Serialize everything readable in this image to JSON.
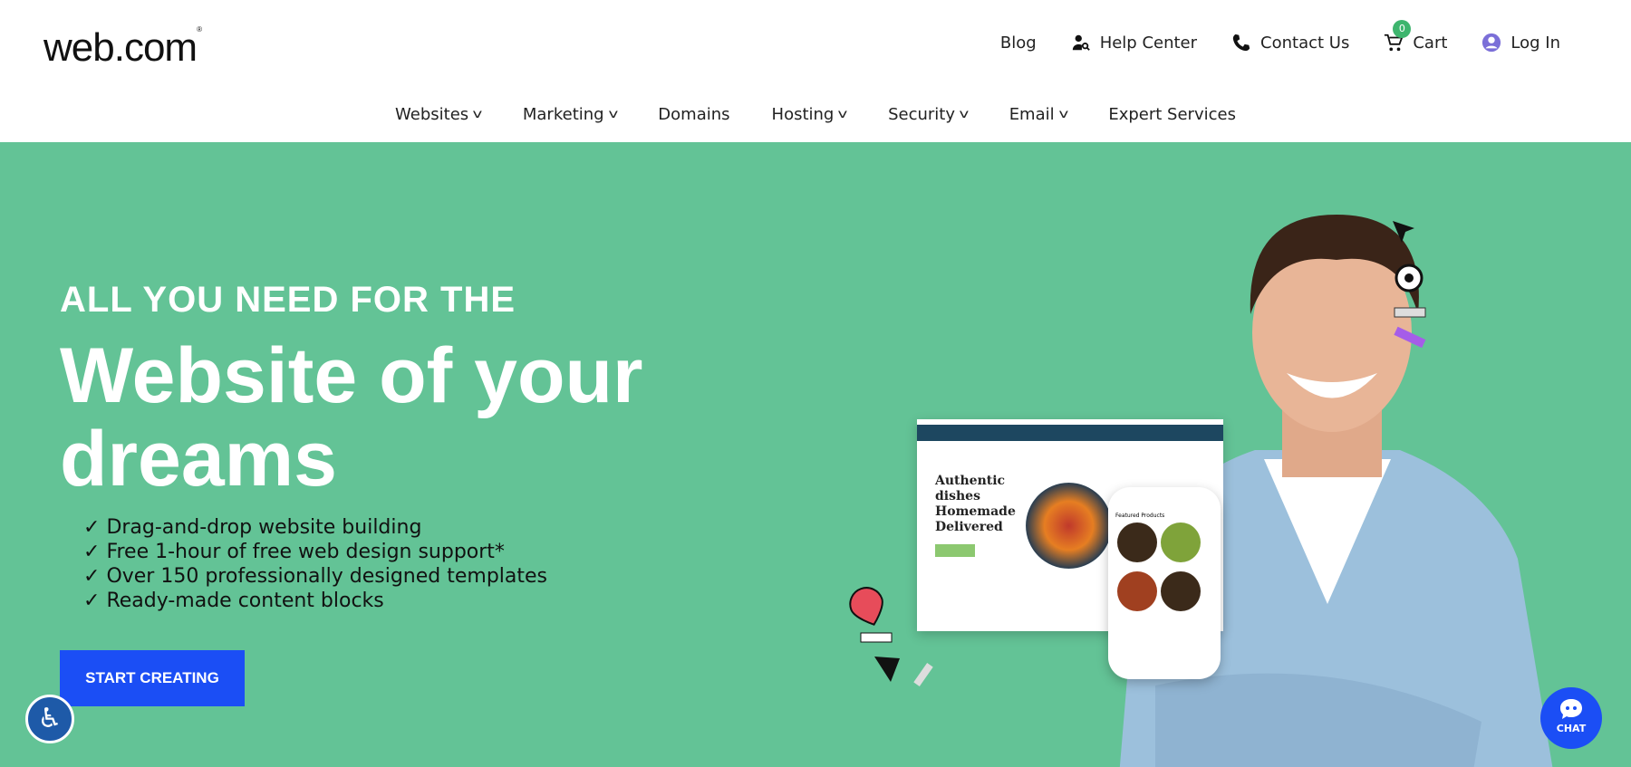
{
  "header": {
    "logo": "web.com",
    "util": [
      {
        "label": "Blog",
        "icon": "none"
      },
      {
        "label": "Help Center",
        "icon": "user-search-icon"
      },
      {
        "label": "Contact Us",
        "icon": "phone-icon"
      },
      {
        "label": "Cart",
        "icon": "cart-icon",
        "badge": "0"
      },
      {
        "label": "Log In",
        "icon": "user-circle-icon"
      }
    ]
  },
  "nav": [
    {
      "label": "Websites",
      "dropdown": true
    },
    {
      "label": "Marketing",
      "dropdown": true
    },
    {
      "label": "Domains",
      "dropdown": false
    },
    {
      "label": "Hosting",
      "dropdown": true
    },
    {
      "label": "Security",
      "dropdown": true
    },
    {
      "label": "Email",
      "dropdown": true
    },
    {
      "label": "Expert Services",
      "dropdown": false
    }
  ],
  "hero": {
    "eyebrow": "ALL YOU NEED FOR THE",
    "title": "Website of your dreams",
    "features": [
      "Drag-and-drop website building",
      "Free 1-hour of free web design support*",
      "Over 150 professionally designed templates",
      "Ready-made content blocks"
    ],
    "cta": "START CREATING",
    "bg_color": "#63c396",
    "cta_color": "#1b4ef5"
  },
  "mockup": {
    "title": "Authentic dishes Homemade Delivered",
    "phone_heading": "Featured Products"
  },
  "chat": {
    "label": "CHAT"
  }
}
